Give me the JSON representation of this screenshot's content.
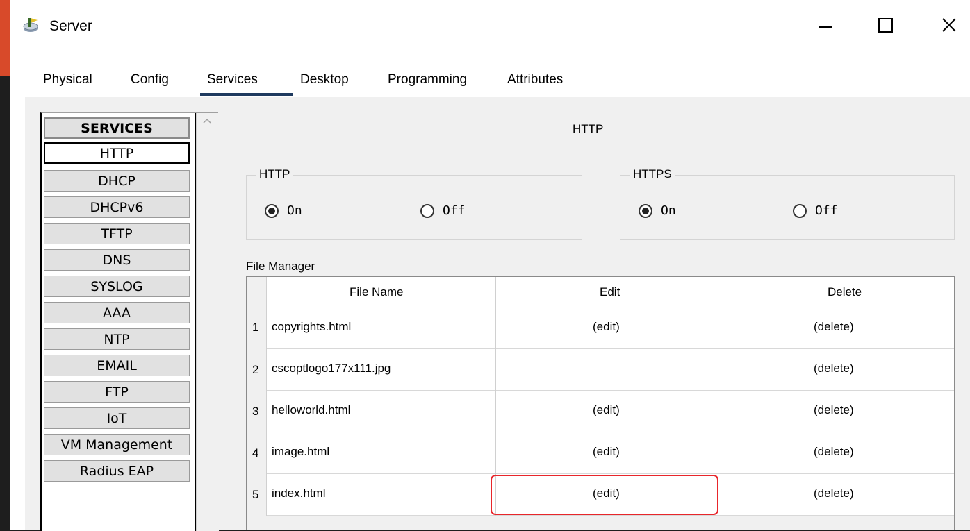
{
  "window": {
    "title": "Server",
    "icon": "router-icon"
  },
  "tabs": [
    {
      "label": "Physical"
    },
    {
      "label": "Config"
    },
    {
      "label": "Services",
      "active": true
    },
    {
      "label": "Desktop"
    },
    {
      "label": "Programming"
    },
    {
      "label": "Attributes"
    }
  ],
  "services": {
    "header": "SERVICES",
    "items": [
      {
        "label": "HTTP",
        "active": true
      },
      {
        "label": "DHCP"
      },
      {
        "label": "DHCPv6"
      },
      {
        "label": "TFTP"
      },
      {
        "label": "DNS"
      },
      {
        "label": "SYSLOG"
      },
      {
        "label": "AAA"
      },
      {
        "label": "NTP"
      },
      {
        "label": "EMAIL"
      },
      {
        "label": "FTP"
      },
      {
        "label": "IoT"
      },
      {
        "label": "VM Management"
      },
      {
        "label": "Radius EAP"
      }
    ]
  },
  "main": {
    "title": "HTTP",
    "http_group": {
      "label": "HTTP",
      "on_label": "On",
      "off_label": "Off",
      "selected": "On"
    },
    "https_group": {
      "label": "HTTPS",
      "on_label": "On",
      "off_label": "Off",
      "selected": "On"
    },
    "file_manager": {
      "label": "File Manager",
      "columns": [
        "File Name",
        "Edit",
        "Delete"
      ],
      "rows": [
        {
          "num": "1",
          "name": "copyrights.html",
          "edit": "(edit)",
          "delete": "(delete)"
        },
        {
          "num": "2",
          "name": "cscoptlogo177x111.jpg",
          "edit": "",
          "delete": "(delete)"
        },
        {
          "num": "3",
          "name": "helloworld.html",
          "edit": "(edit)",
          "delete": "(delete)"
        },
        {
          "num": "4",
          "name": "image.html",
          "edit": "(edit)",
          "delete": "(delete)"
        },
        {
          "num": "5",
          "name": "index.html",
          "edit": "(edit)",
          "delete": "(delete)"
        }
      ]
    }
  },
  "colors": {
    "accent_titlebar": "#d84a2a",
    "tab_underline": "#1f3a5f",
    "highlight": "#e8262b"
  }
}
